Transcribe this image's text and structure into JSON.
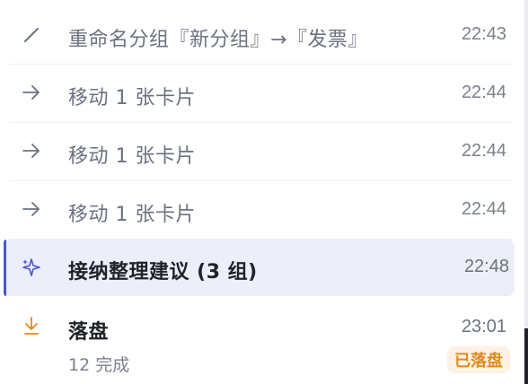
{
  "colors": {
    "accent": "#4a57c9",
    "highlight_bg": "#eceefa",
    "done_orange": "#e08a1e",
    "badge_bg": "#fdf1e3",
    "muted_text": "#6b7280"
  },
  "history": [
    {
      "icon": "pencil-icon",
      "label": "重命名分组『新分组』→『发票』",
      "time": "22:43"
    },
    {
      "icon": "arrow-right-icon",
      "label": "移动 1 张卡片",
      "time": "22:44"
    },
    {
      "icon": "arrow-right-icon",
      "label": "移动 1 张卡片",
      "time": "22:44"
    },
    {
      "icon": "arrow-right-icon",
      "label": "移动 1 张卡片",
      "time": "22:44"
    },
    {
      "icon": "sparkle-icon",
      "label": "接纳整理建议 (3 组)",
      "time": "22:48",
      "highlighted": true
    },
    {
      "icon": "download-icon",
      "label": "落盘",
      "time": "23:01",
      "subtitle": "12 完成",
      "badge": "已落盘"
    }
  ]
}
